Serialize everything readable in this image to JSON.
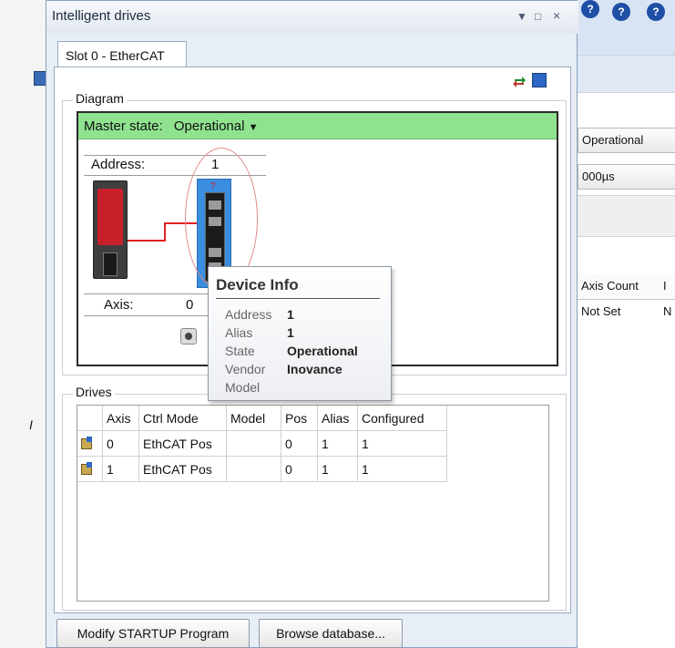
{
  "window": {
    "title": "Intelligent drives",
    "tab": "Slot 0 - EtherCAT"
  },
  "background": {
    "state_value": "Operational",
    "period_value": "000µs",
    "axis_count_header": "Axis Count",
    "axis_count_value": "Not Set",
    "col_i": "I",
    "col_n": "N",
    "help_icons": [
      "?",
      "?",
      "?"
    ],
    "left_glyph": "I"
  },
  "diagram": {
    "group_label": "Diagram",
    "master_state_label": "Master state:",
    "master_state_value": "Operational",
    "address_label": "Address:",
    "address_value": "1",
    "axis_label": "Axis:",
    "axis_value": "0",
    "drive_marker": "?"
  },
  "tooltip": {
    "title": "Device Info",
    "rows": [
      {
        "key": "Address",
        "value": "1"
      },
      {
        "key": "Alias",
        "value": "1"
      },
      {
        "key": "State",
        "value": "Operational"
      },
      {
        "key": "Vendor",
        "value": "Inovance"
      },
      {
        "key": "Model",
        "value": ""
      }
    ]
  },
  "drives": {
    "group_label": "Drives",
    "columns": [
      "Axis",
      "Ctrl Mode",
      "Model",
      "Pos",
      "Alias",
      "Configured"
    ],
    "rows": [
      [
        "0",
        "EthCAT Pos",
        "",
        "0",
        "1",
        "1"
      ],
      [
        "1",
        "EthCAT Pos",
        "",
        "0",
        "1",
        "1"
      ]
    ]
  },
  "buttons": {
    "modify_startup": "Modify STARTUP Program",
    "browse_db": "Browse database..."
  },
  "colors": {
    "master_bar": "#8fe38f",
    "drive_blue": "#3b8de0",
    "highlight_ellipse": "#e08a8a"
  }
}
